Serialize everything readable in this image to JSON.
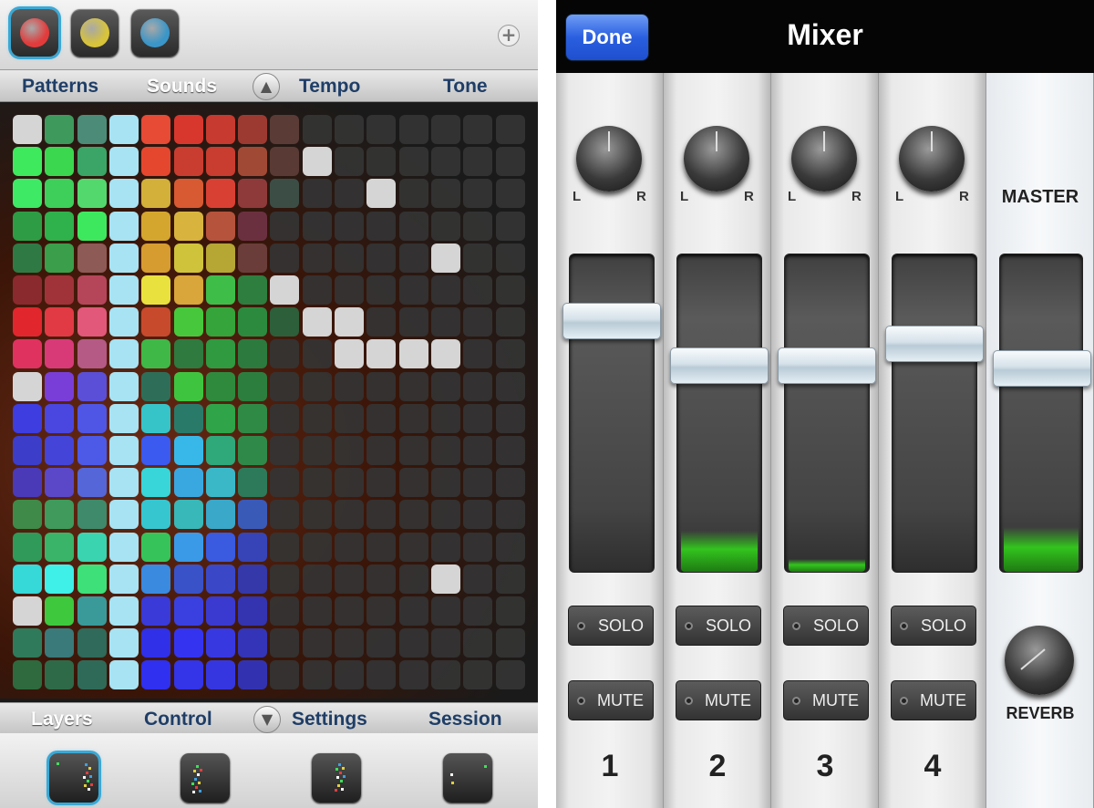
{
  "sequencer": {
    "swatches": [
      {
        "name": "red",
        "color": "#e23b3b",
        "active": true
      },
      {
        "name": "yellow",
        "color": "#d8c43a",
        "active": false
      },
      {
        "name": "blue",
        "color": "#3a96c8",
        "active": false
      }
    ],
    "add_symbol": "+",
    "top_tabs": [
      "Patterns",
      "Sounds",
      "Tempo",
      "Tone"
    ],
    "top_tab_selected": "Sounds",
    "up_arrow": "▲",
    "bottom_tabs": [
      "Layers",
      "Control",
      "Settings",
      "Session"
    ],
    "bottom_tab_selected": "Layers",
    "down_arrow": "▼",
    "layer_thumbnails": 4,
    "grid": {
      "columns": 16,
      "rows": 18,
      "lit_cells": [
        [
          0,
          0,
          "#d5d5d5"
        ],
        [
          0,
          1,
          "#3e9a5c"
        ],
        [
          0,
          2,
          "#4c8b78"
        ],
        [
          0,
          3,
          "#a7e3f3"
        ],
        [
          0,
          4,
          "#e74a35"
        ],
        [
          0,
          5,
          "#d8372e"
        ],
        [
          0,
          6,
          "#c63a30"
        ],
        [
          0,
          7,
          "#9c3a32"
        ],
        [
          0,
          8,
          "#5a3b36"
        ],
        [
          1,
          0,
          "#3ee95e"
        ],
        [
          1,
          1,
          "#3bd84f"
        ],
        [
          1,
          2,
          "#3aa566"
        ],
        [
          1,
          3,
          "#a7e3f3"
        ],
        [
          1,
          4,
          "#e5472e"
        ],
        [
          1,
          5,
          "#c93d30"
        ],
        [
          1,
          6,
          "#c93c30"
        ],
        [
          1,
          7,
          "#a04a36"
        ],
        [
          1,
          8,
          "#5a3a34"
        ],
        [
          1,
          9,
          "#d5d5d5"
        ],
        [
          2,
          0,
          "#3ee965"
        ],
        [
          2,
          1,
          "#3dcf5a"
        ],
        [
          2,
          2,
          "#53d86d"
        ],
        [
          2,
          3,
          "#a7e3f3"
        ],
        [
          2,
          4,
          "#d2b03a"
        ],
        [
          2,
          5,
          "#d75a32"
        ],
        [
          2,
          6,
          "#d94034"
        ],
        [
          2,
          7,
          "#8e3a3a"
        ],
        [
          2,
          8,
          "#3c4d45"
        ],
        [
          2,
          11,
          "#d5d5d5"
        ],
        [
          3,
          0,
          "#2e9c44"
        ],
        [
          3,
          1,
          "#2fb14b"
        ],
        [
          3,
          2,
          "#3ee85e"
        ],
        [
          3,
          3,
          "#a7e3f3"
        ],
        [
          3,
          4,
          "#d4a62e"
        ],
        [
          3,
          5,
          "#d8b43f"
        ],
        [
          3,
          6,
          "#b6533c"
        ],
        [
          3,
          7,
          "#6a3040"
        ],
        [
          4,
          0,
          "#2f7a44"
        ],
        [
          4,
          1,
          "#3a9e4a"
        ],
        [
          4,
          2,
          "#8e5a55"
        ],
        [
          4,
          3,
          "#a7e3f3"
        ],
        [
          4,
          4,
          "#d79c30"
        ],
        [
          4,
          5,
          "#cfc33b"
        ],
        [
          4,
          6,
          "#b6a634"
        ],
        [
          4,
          7,
          "#6a3d3a"
        ],
        [
          4,
          13,
          "#d5d5d5"
        ],
        [
          5,
          0,
          "#8b2a2e"
        ],
        [
          5,
          1,
          "#a0333a"
        ],
        [
          5,
          2,
          "#b5465a"
        ],
        [
          5,
          3,
          "#a7e3f3"
        ],
        [
          5,
          4,
          "#e9e23e"
        ],
        [
          5,
          5,
          "#d8a63a"
        ],
        [
          5,
          6,
          "#3fbd49"
        ],
        [
          5,
          7,
          "#2d7e3f"
        ],
        [
          5,
          8,
          "#d5d5d5"
        ],
        [
          6,
          0,
          "#e2262d"
        ],
        [
          6,
          1,
          "#e23a44"
        ],
        [
          6,
          2,
          "#e2587a"
        ],
        [
          6,
          3,
          "#a7e3f3"
        ],
        [
          6,
          4,
          "#c84a2c"
        ],
        [
          6,
          5,
          "#47c83c"
        ],
        [
          6,
          6,
          "#35a43a"
        ],
        [
          6,
          7,
          "#2c8a3e"
        ],
        [
          6,
          8,
          "#2c5f3a"
        ],
        [
          6,
          9,
          "#d5d5d5"
        ],
        [
          6,
          10,
          "#d5d5d5"
        ],
        [
          7,
          0,
          "#e0325f"
        ],
        [
          7,
          1,
          "#d83a78"
        ],
        [
          7,
          2,
          "#b45a85"
        ],
        [
          7,
          3,
          "#a7e3f3"
        ],
        [
          7,
          4,
          "#3fb847"
        ],
        [
          7,
          5,
          "#2f7a3e"
        ],
        [
          7,
          6,
          "#2f9a40"
        ],
        [
          7,
          7,
          "#2c7a3e"
        ],
        [
          7,
          10,
          "#d5d5d5"
        ],
        [
          7,
          11,
          "#d5d5d5"
        ],
        [
          7,
          12,
          "#d5d5d5"
        ],
        [
          7,
          13,
          "#d5d5d5"
        ],
        [
          8,
          0,
          "#d5d5d5"
        ],
        [
          8,
          1,
          "#7a3ed8"
        ],
        [
          8,
          2,
          "#5b4fd8"
        ],
        [
          8,
          3,
          "#a7e3f3"
        ],
        [
          8,
          4,
          "#2e6e58"
        ],
        [
          8,
          5,
          "#3fc43f"
        ],
        [
          8,
          6,
          "#2f8a3e"
        ],
        [
          8,
          7,
          "#2c7e3e"
        ],
        [
          9,
          0,
          "#3d3de0"
        ],
        [
          9,
          1,
          "#4a47e0"
        ],
        [
          9,
          2,
          "#4f55e5"
        ],
        [
          9,
          3,
          "#a7e3f3"
        ],
        [
          9,
          4,
          "#36c4c8"
        ],
        [
          9,
          5,
          "#2a7a6a"
        ],
        [
          9,
          6,
          "#2fa448"
        ],
        [
          9,
          7,
          "#2f8a46"
        ],
        [
          10,
          0,
          "#3c3dc8"
        ],
        [
          10,
          1,
          "#4444d8"
        ],
        [
          10,
          2,
          "#4d5ae8"
        ],
        [
          10,
          3,
          "#a7e3f3"
        ],
        [
          10,
          4,
          "#3b5af0"
        ],
        [
          10,
          5,
          "#38b8e8"
        ],
        [
          10,
          6,
          "#2fa87a"
        ],
        [
          10,
          7,
          "#2f8a4a"
        ],
        [
          11,
          0,
          "#4a3ab8"
        ],
        [
          11,
          1,
          "#5a48c8"
        ],
        [
          11,
          2,
          "#5566d8"
        ],
        [
          11,
          3,
          "#a7e3f3"
        ],
        [
          11,
          4,
          "#38d6d8"
        ],
        [
          11,
          5,
          "#3aa8e0"
        ],
        [
          11,
          6,
          "#3ab8c8"
        ],
        [
          11,
          7,
          "#2c7a5a"
        ],
        [
          12,
          0,
          "#3f8a48"
        ],
        [
          12,
          1,
          "#3f9a5c"
        ],
        [
          12,
          2,
          "#3f8a6a"
        ],
        [
          12,
          3,
          "#a7e3f3"
        ],
        [
          12,
          4,
          "#36c6d0"
        ],
        [
          12,
          5,
          "#38b8b8"
        ],
        [
          12,
          6,
          "#3aa8c8"
        ],
        [
          12,
          7,
          "#3a5ab8"
        ],
        [
          13,
          0,
          "#2f9a5a"
        ],
        [
          13,
          1,
          "#3ab468"
        ],
        [
          13,
          2,
          "#3ad4b0"
        ],
        [
          13,
          3,
          "#a7e3f3"
        ],
        [
          13,
          4,
          "#36c45a"
        ],
        [
          13,
          5,
          "#3a9ae8"
        ],
        [
          13,
          6,
          "#3a5ae0"
        ],
        [
          13,
          7,
          "#3644b8"
        ],
        [
          14,
          0,
          "#36d8d8"
        ],
        [
          14,
          1,
          "#3ef0e8"
        ],
        [
          14,
          2,
          "#3ee07a"
        ],
        [
          14,
          3,
          "#a7e3f3"
        ],
        [
          14,
          4,
          "#3a8ae0"
        ],
        [
          14,
          5,
          "#3a52c8"
        ],
        [
          14,
          6,
          "#3a48c8"
        ],
        [
          14,
          7,
          "#3438a8"
        ],
        [
          14,
          13,
          "#d5d5d5"
        ],
        [
          15,
          0,
          "#d5d5d5"
        ],
        [
          15,
          1,
          "#3ec83e"
        ],
        [
          15,
          2,
          "#3a9a9a"
        ],
        [
          15,
          3,
          "#a7e3f3"
        ],
        [
          15,
          4,
          "#3a3ad8"
        ],
        [
          15,
          5,
          "#3a40e0"
        ],
        [
          15,
          6,
          "#3a3ad0"
        ],
        [
          15,
          7,
          "#3434b0"
        ],
        [
          16,
          0,
          "#2f7a5a"
        ],
        [
          16,
          1,
          "#3a7a7a"
        ],
        [
          16,
          2,
          "#2f6a5a"
        ],
        [
          16,
          3,
          "#a7e3f3"
        ],
        [
          16,
          4,
          "#3030e8"
        ],
        [
          16,
          5,
          "#3434f0"
        ],
        [
          16,
          6,
          "#3838e0"
        ],
        [
          16,
          7,
          "#3434b8"
        ],
        [
          17,
          0,
          "#2e6a3e"
        ],
        [
          17,
          1,
          "#2f6a48"
        ],
        [
          17,
          2,
          "#2f6a58"
        ],
        [
          17,
          3,
          "#a7e3f3"
        ],
        [
          17,
          4,
          "#3030f0"
        ],
        [
          17,
          5,
          "#3434e8"
        ],
        [
          17,
          6,
          "#3636e0"
        ],
        [
          17,
          7,
          "#3232b0"
        ]
      ]
    }
  },
  "mixer": {
    "done_label": "Done",
    "title": "Mixer",
    "channels": [
      {
        "number": "1",
        "level_percent": 0,
        "fader_percent": 83
      },
      {
        "number": "2",
        "level_percent": 13,
        "fader_percent": 67
      },
      {
        "number": "3",
        "level_percent": 4,
        "fader_percent": 67
      },
      {
        "number": "4",
        "level_percent": 0,
        "fader_percent": 75
      }
    ],
    "pan_left": "L",
    "pan_right": "R",
    "solo_label": "SOLO",
    "mute_label": "MUTE",
    "master_label": "MASTER",
    "master": {
      "level_percent": 14,
      "fader_percent": 66
    },
    "reverb_label": "REVERB"
  }
}
